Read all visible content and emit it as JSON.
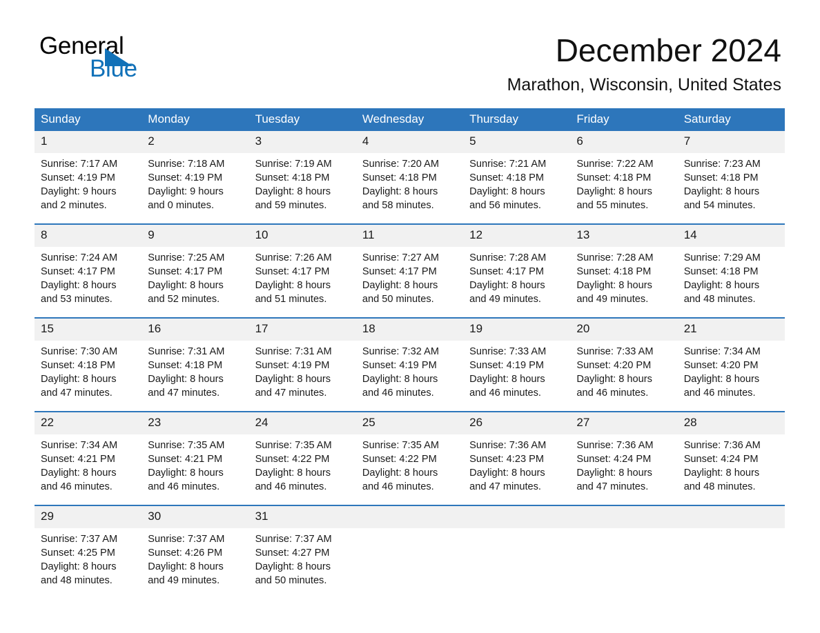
{
  "brand": {
    "name_part1": "General",
    "name_part2": "Blue",
    "accent_color": "#1171b8"
  },
  "header": {
    "title": "December 2024",
    "location": "Marathon, Wisconsin, United States",
    "header_bg": "#2d76bb",
    "daynum_bg": "#f1f1f1"
  },
  "weekdays": [
    "Sunday",
    "Monday",
    "Tuesday",
    "Wednesday",
    "Thursday",
    "Friday",
    "Saturday"
  ],
  "days": [
    {
      "num": "1",
      "sunrise": "Sunrise: 7:17 AM",
      "sunset": "Sunset: 4:19 PM",
      "daylight1": "Daylight: 9 hours",
      "daylight2": "and 2 minutes."
    },
    {
      "num": "2",
      "sunrise": "Sunrise: 7:18 AM",
      "sunset": "Sunset: 4:19 PM",
      "daylight1": "Daylight: 9 hours",
      "daylight2": "and 0 minutes."
    },
    {
      "num": "3",
      "sunrise": "Sunrise: 7:19 AM",
      "sunset": "Sunset: 4:18 PM",
      "daylight1": "Daylight: 8 hours",
      "daylight2": "and 59 minutes."
    },
    {
      "num": "4",
      "sunrise": "Sunrise: 7:20 AM",
      "sunset": "Sunset: 4:18 PM",
      "daylight1": "Daylight: 8 hours",
      "daylight2": "and 58 minutes."
    },
    {
      "num": "5",
      "sunrise": "Sunrise: 7:21 AM",
      "sunset": "Sunset: 4:18 PM",
      "daylight1": "Daylight: 8 hours",
      "daylight2": "and 56 minutes."
    },
    {
      "num": "6",
      "sunrise": "Sunrise: 7:22 AM",
      "sunset": "Sunset: 4:18 PM",
      "daylight1": "Daylight: 8 hours",
      "daylight2": "and 55 minutes."
    },
    {
      "num": "7",
      "sunrise": "Sunrise: 7:23 AM",
      "sunset": "Sunset: 4:18 PM",
      "daylight1": "Daylight: 8 hours",
      "daylight2": "and 54 minutes."
    },
    {
      "num": "8",
      "sunrise": "Sunrise: 7:24 AM",
      "sunset": "Sunset: 4:17 PM",
      "daylight1": "Daylight: 8 hours",
      "daylight2": "and 53 minutes."
    },
    {
      "num": "9",
      "sunrise": "Sunrise: 7:25 AM",
      "sunset": "Sunset: 4:17 PM",
      "daylight1": "Daylight: 8 hours",
      "daylight2": "and 52 minutes."
    },
    {
      "num": "10",
      "sunrise": "Sunrise: 7:26 AM",
      "sunset": "Sunset: 4:17 PM",
      "daylight1": "Daylight: 8 hours",
      "daylight2": "and 51 minutes."
    },
    {
      "num": "11",
      "sunrise": "Sunrise: 7:27 AM",
      "sunset": "Sunset: 4:17 PM",
      "daylight1": "Daylight: 8 hours",
      "daylight2": "and 50 minutes."
    },
    {
      "num": "12",
      "sunrise": "Sunrise: 7:28 AM",
      "sunset": "Sunset: 4:17 PM",
      "daylight1": "Daylight: 8 hours",
      "daylight2": "and 49 minutes."
    },
    {
      "num": "13",
      "sunrise": "Sunrise: 7:28 AM",
      "sunset": "Sunset: 4:18 PM",
      "daylight1": "Daylight: 8 hours",
      "daylight2": "and 49 minutes."
    },
    {
      "num": "14",
      "sunrise": "Sunrise: 7:29 AM",
      "sunset": "Sunset: 4:18 PM",
      "daylight1": "Daylight: 8 hours",
      "daylight2": "and 48 minutes."
    },
    {
      "num": "15",
      "sunrise": "Sunrise: 7:30 AM",
      "sunset": "Sunset: 4:18 PM",
      "daylight1": "Daylight: 8 hours",
      "daylight2": "and 47 minutes."
    },
    {
      "num": "16",
      "sunrise": "Sunrise: 7:31 AM",
      "sunset": "Sunset: 4:18 PM",
      "daylight1": "Daylight: 8 hours",
      "daylight2": "and 47 minutes."
    },
    {
      "num": "17",
      "sunrise": "Sunrise: 7:31 AM",
      "sunset": "Sunset: 4:19 PM",
      "daylight1": "Daylight: 8 hours",
      "daylight2": "and 47 minutes."
    },
    {
      "num": "18",
      "sunrise": "Sunrise: 7:32 AM",
      "sunset": "Sunset: 4:19 PM",
      "daylight1": "Daylight: 8 hours",
      "daylight2": "and 46 minutes."
    },
    {
      "num": "19",
      "sunrise": "Sunrise: 7:33 AM",
      "sunset": "Sunset: 4:19 PM",
      "daylight1": "Daylight: 8 hours",
      "daylight2": "and 46 minutes."
    },
    {
      "num": "20",
      "sunrise": "Sunrise: 7:33 AM",
      "sunset": "Sunset: 4:20 PM",
      "daylight1": "Daylight: 8 hours",
      "daylight2": "and 46 minutes."
    },
    {
      "num": "21",
      "sunrise": "Sunrise: 7:34 AM",
      "sunset": "Sunset: 4:20 PM",
      "daylight1": "Daylight: 8 hours",
      "daylight2": "and 46 minutes."
    },
    {
      "num": "22",
      "sunrise": "Sunrise: 7:34 AM",
      "sunset": "Sunset: 4:21 PM",
      "daylight1": "Daylight: 8 hours",
      "daylight2": "and 46 minutes."
    },
    {
      "num": "23",
      "sunrise": "Sunrise: 7:35 AM",
      "sunset": "Sunset: 4:21 PM",
      "daylight1": "Daylight: 8 hours",
      "daylight2": "and 46 minutes."
    },
    {
      "num": "24",
      "sunrise": "Sunrise: 7:35 AM",
      "sunset": "Sunset: 4:22 PM",
      "daylight1": "Daylight: 8 hours",
      "daylight2": "and 46 minutes."
    },
    {
      "num": "25",
      "sunrise": "Sunrise: 7:35 AM",
      "sunset": "Sunset: 4:22 PM",
      "daylight1": "Daylight: 8 hours",
      "daylight2": "and 46 minutes."
    },
    {
      "num": "26",
      "sunrise": "Sunrise: 7:36 AM",
      "sunset": "Sunset: 4:23 PM",
      "daylight1": "Daylight: 8 hours",
      "daylight2": "and 47 minutes."
    },
    {
      "num": "27",
      "sunrise": "Sunrise: 7:36 AM",
      "sunset": "Sunset: 4:24 PM",
      "daylight1": "Daylight: 8 hours",
      "daylight2": "and 47 minutes."
    },
    {
      "num": "28",
      "sunrise": "Sunrise: 7:36 AM",
      "sunset": "Sunset: 4:24 PM",
      "daylight1": "Daylight: 8 hours",
      "daylight2": "and 48 minutes."
    },
    {
      "num": "29",
      "sunrise": "Sunrise: 7:37 AM",
      "sunset": "Sunset: 4:25 PM",
      "daylight1": "Daylight: 8 hours",
      "daylight2": "and 48 minutes."
    },
    {
      "num": "30",
      "sunrise": "Sunrise: 7:37 AM",
      "sunset": "Sunset: 4:26 PM",
      "daylight1": "Daylight: 8 hours",
      "daylight2": "and 49 minutes."
    },
    {
      "num": "31",
      "sunrise": "Sunrise: 7:37 AM",
      "sunset": "Sunset: 4:27 PM",
      "daylight1": "Daylight: 8 hours",
      "daylight2": "and 50 minutes."
    }
  ]
}
